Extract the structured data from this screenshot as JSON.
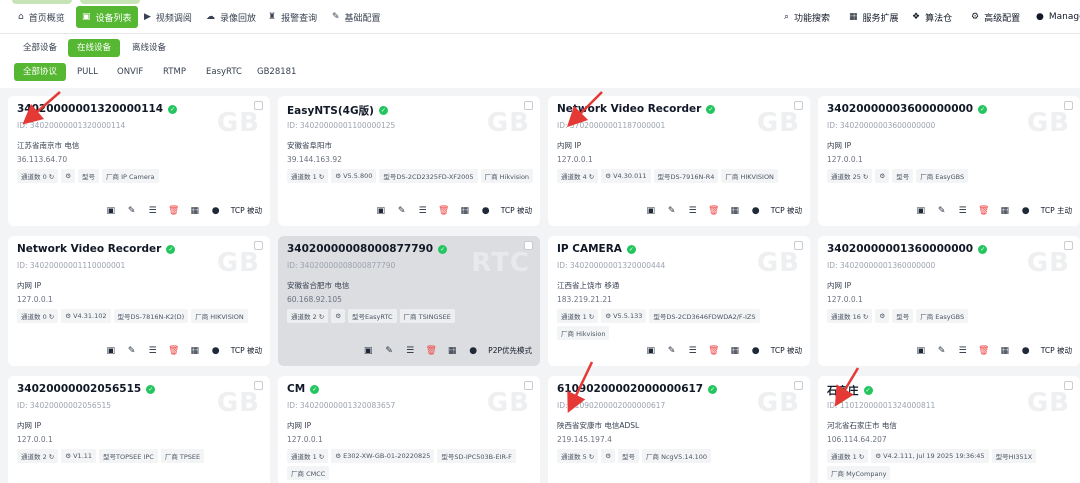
{
  "nav": {
    "items": [
      {
        "label": "首页概览",
        "icon": "home-icon",
        "glyph": "⌂",
        "active": false
      },
      {
        "label": "设备列表",
        "icon": "device-list-icon",
        "glyph": "▣",
        "active": true
      },
      {
        "label": "视频调阅",
        "icon": "play-icon",
        "glyph": "▶",
        "active": false
      },
      {
        "label": "录像回放",
        "icon": "cloud-icon",
        "glyph": "☁",
        "active": false
      },
      {
        "label": "报警查询",
        "icon": "alarm-icon",
        "glyph": "♜",
        "active": false
      },
      {
        "label": "基础配置",
        "icon": "edit-icon",
        "glyph": "✎",
        "active": false
      }
    ],
    "right": [
      {
        "label": "功能搜索",
        "icon": "search-icon",
        "glyph": "⌕"
      },
      {
        "label": "服务扩展",
        "icon": "grid-icon",
        "glyph": "▦"
      },
      {
        "label": "算法仓",
        "icon": "box-icon",
        "glyph": "❖"
      },
      {
        "label": "高级配置",
        "icon": "gear-icon",
        "glyph": "⚙"
      },
      {
        "label": "Manage",
        "icon": "user-icon",
        "glyph": "●"
      }
    ]
  },
  "filters": {
    "status": [
      "全部设备",
      "在线设备",
      "离线设备"
    ],
    "status_active": 1,
    "protocol": [
      "全部协议",
      "PULL",
      "ONVIF",
      "RTMP",
      "EasyRTC",
      "GB28181"
    ],
    "protocol_active": 0
  },
  "cards": [
    {
      "title": "34020000001320000114",
      "id": "ID: 34020000001320000114",
      "loc": "江苏省南京市 电信",
      "ip": "36.113.64.70",
      "tags": [
        "通道数 0 ↻",
        "⚙",
        "型号",
        "厂商 IP Camera"
      ],
      "mode": "TCP 被动",
      "wm": "GB",
      "gray": false
    },
    {
      "title": "EasyNTS(4G版)",
      "id": "ID: 34020000001100000125",
      "loc": "安徽省阜阳市",
      "ip": "39.144.163.92",
      "tags": [
        "通道数 1 ↻",
        "⚙ V5.5.800",
        "型号DS-2CD2325FD-XF2005",
        "厂商 Hikvision"
      ],
      "mode": "TCP 被动",
      "wm": "GB",
      "gray": false
    },
    {
      "title": "Network Video Recorder",
      "id": "ID: 37020000001187000001",
      "loc": "内网 IP",
      "ip": "127.0.0.1",
      "tags": [
        "通道数 4 ↻",
        "⚙ V4.30.011",
        "型号DS-7916N-R4",
        "厂商 HIKVISION"
      ],
      "mode": "TCP 被动",
      "wm": "GB",
      "gray": false
    },
    {
      "title": "34020000003600000000",
      "id": "ID: 34020000003600000000",
      "loc": "内网 IP",
      "ip": "127.0.0.1",
      "tags": [
        "通道数 25 ↻",
        "⚙",
        "型号",
        "厂商 EasyGBS"
      ],
      "mode": "TCP 主动",
      "wm": "GB",
      "gray": false
    },
    {
      "title": "Network Video Recorder",
      "id": "ID: 34020000001110000001",
      "loc": "内网 IP",
      "ip": "127.0.0.1",
      "tags": [
        "通道数 0 ↻",
        "⚙ V4.31.102",
        "型号DS-7816N-K2(D)",
        "厂商 HIKVISION"
      ],
      "mode": "TCP 被动",
      "wm": "GB",
      "gray": false
    },
    {
      "title": "34020000008000877790",
      "id": "ID: 34020000008000877790",
      "loc": "安徽省合肥市 电信",
      "ip": "60.168.92.105",
      "tags": [
        "通道数 2 ↻",
        "⚙",
        "型号EasyRTC",
        "厂商 TSINGSEE"
      ],
      "mode": "P2P优先模式",
      "wm": "RTC",
      "gray": true
    },
    {
      "title": "IP CAMERA",
      "id": "ID: 34020000001320000444",
      "loc": "江西省上饶市 移通",
      "ip": "183.219.21.21",
      "tags": [
        "通道数 1 ↻",
        "⚙ V5.5.133",
        "型号DS-2CD3646FDWDA2/F-IZS",
        "厂商 Hikvision"
      ],
      "mode": "TCP 被动",
      "wm": "GB",
      "gray": false
    },
    {
      "title": "34020000001360000000",
      "id": "ID: 34020000001360000000",
      "loc": "内网 IP",
      "ip": "127.0.0.1",
      "tags": [
        "通道数 16 ↻",
        "⚙",
        "型号",
        "厂商 EasyGBS"
      ],
      "mode": "TCP 被动",
      "wm": "GB",
      "gray": false
    },
    {
      "title": "34020000002056515",
      "id": "ID: 34020000002056515",
      "loc": "内网 IP",
      "ip": "127.0.0.1",
      "tags": [
        "通道数 2 ↻",
        "⚙ V1.11",
        "型号TOPSEE IPC",
        "厂商 TPSEE"
      ],
      "mode": "",
      "wm": "GB",
      "gray": false
    },
    {
      "title": "CM",
      "id": "ID: 34020000001320083657",
      "loc": "内网 IP",
      "ip": "127.0.0.1",
      "tags": [
        "通道数 1 ↻",
        "⚙ E302-XW-GB-01-20220825",
        "型号SD-IPC503B-EIR-F",
        "厂商 CMCC"
      ],
      "mode": "",
      "wm": "GB",
      "gray": false
    },
    {
      "title": "61090200002000000617",
      "id": "ID: 61090200002000000617",
      "loc": "陕西省安康市 电信ADSL",
      "ip": "219.145.197.4",
      "tags": [
        "通道数 5 ↻",
        "⚙",
        "型号",
        "厂商 NcgV5.14.100"
      ],
      "mode": "",
      "wm": "GB",
      "gray": false
    },
    {
      "title": "石家庄",
      "id": "ID: 11012000001324000811",
      "loc": "河北省石家庄市 电信",
      "ip": "106.114.64.207",
      "tags": [
        "通道数 1 ↻",
        "⚙ V4.2.111, Jul 19 2025 19:36:45",
        "型号HI351X",
        "厂商 MyCompany"
      ],
      "mode": "",
      "wm": "GB",
      "gray": false
    }
  ],
  "card_actions": [
    {
      "name": "snapshot-icon",
      "glyph": "▣"
    },
    {
      "name": "edit-icon",
      "glyph": "✎"
    },
    {
      "name": "list-icon",
      "glyph": "☰"
    },
    {
      "name": "delete-icon",
      "glyph": "🗑"
    },
    {
      "name": "qrcode-icon",
      "glyph": "▦"
    },
    {
      "name": "user-icon",
      "glyph": "●"
    }
  ],
  "colors": {
    "accent": "#55b732",
    "online": "#22c55e",
    "delete": "#ef4444",
    "arrow": "#e53935"
  }
}
